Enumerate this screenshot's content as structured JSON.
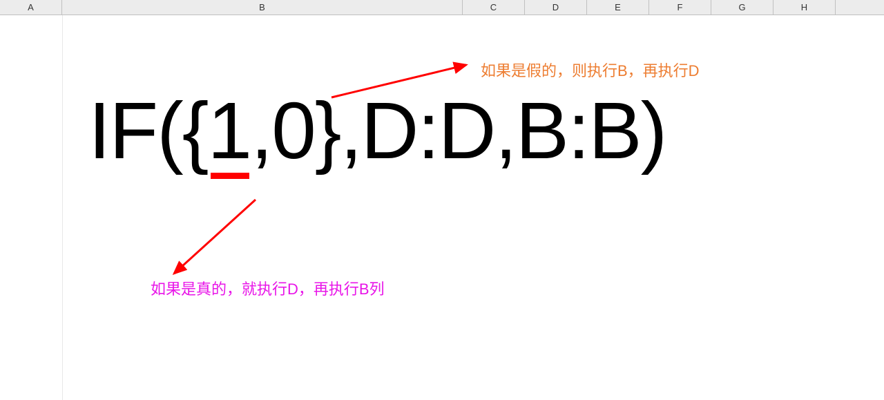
{
  "columns": {
    "A": "A",
    "B": "B",
    "C": "C",
    "D": "D",
    "E": "E",
    "F": "F",
    "G": "G",
    "H": "H"
  },
  "content": {
    "formula": "IF({1,0},D:D,B:B)",
    "annotation_false": "如果是假的，则执行B，再执行D",
    "annotation_true": "如果是真的，就执行D，再执行B列"
  },
  "colors": {
    "header_bg": "#ececec",
    "annotation_false": "#ed7d31",
    "annotation_true": "#e815e8",
    "arrow": "#ff0000"
  }
}
